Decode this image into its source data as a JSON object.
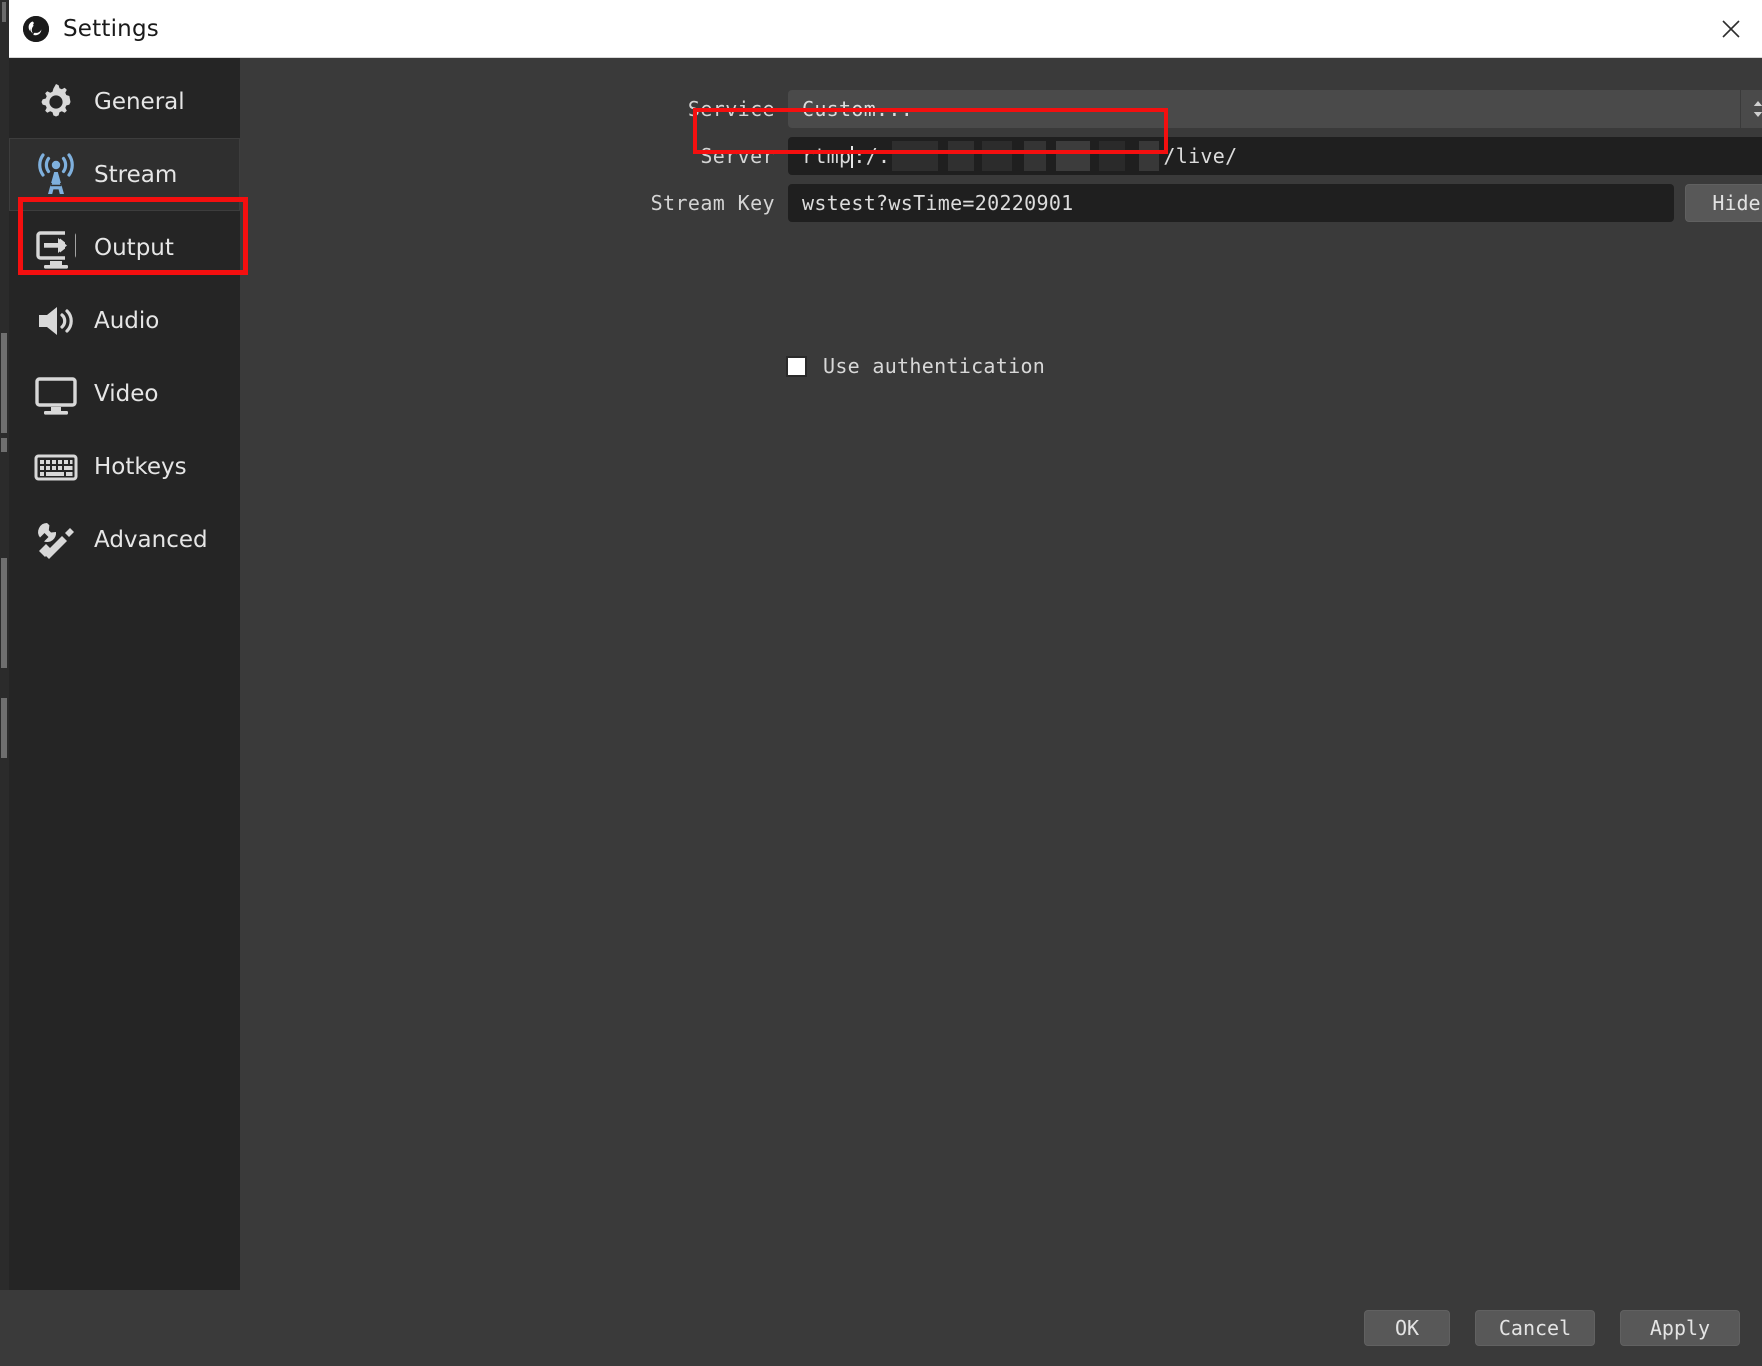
{
  "window": {
    "title": "Settings",
    "logo_icon": "obs-logo-icon",
    "close_icon": "close-icon"
  },
  "sidebar": {
    "items": [
      {
        "label": "General",
        "icon": "gear-icon",
        "selected": false
      },
      {
        "label": "Stream",
        "icon": "broadcast-icon",
        "selected": true
      },
      {
        "label": "Output",
        "icon": "output-icon",
        "selected": false
      },
      {
        "label": "Audio",
        "icon": "speaker-icon",
        "selected": false
      },
      {
        "label": "Video",
        "icon": "monitor-icon",
        "selected": false
      },
      {
        "label": "Hotkeys",
        "icon": "keyboard-icon",
        "selected": false
      },
      {
        "label": "Advanced",
        "icon": "tools-icon",
        "selected": false
      }
    ]
  },
  "main": {
    "service": {
      "label": "Service",
      "value": "Custom...",
      "dropdown_icon": "spinner-arrows-icon"
    },
    "server": {
      "label": "Server",
      "value_prefix": "rtmp",
      "value_mid": ":/.",
      "value_suffix": "/live/",
      "redacted": true
    },
    "stream_key": {
      "label": "Stream Key",
      "value": "wstest?wsTime=20220901",
      "hide_button": "Hide"
    },
    "use_authentication": {
      "label": "Use authentication",
      "checked": false
    }
  },
  "footer": {
    "ok": "OK",
    "cancel": "Cancel",
    "apply": "Apply"
  },
  "annotations": {
    "highlight_color": "#f40f0f",
    "boxes": [
      "stream-nav-highlight",
      "server-field-highlight"
    ]
  }
}
